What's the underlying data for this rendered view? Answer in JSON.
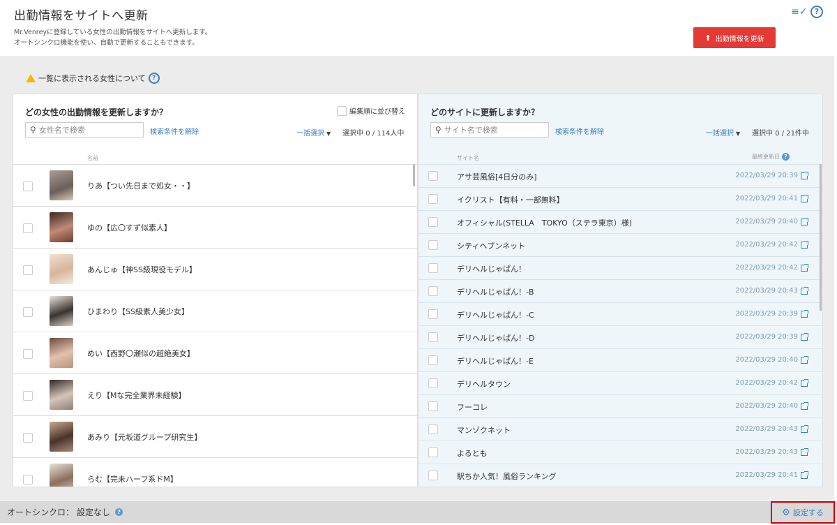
{
  "header": {
    "title": "出勤情報をサイトへ更新",
    "desc_line1": "Mr.Venreyに登録している女性の出勤情報をサイトへ更新します。",
    "desc_line2": "オートシンクロ機能を使い、自動で更新することもできます。",
    "update_button": "出勤情報を更新"
  },
  "notice": {
    "text": "一覧に表示される女性について"
  },
  "left_panel": {
    "title": "どの女性の出勤情報を更新しますか？",
    "sort_label": "編集順に並び替え",
    "search_placeholder": "女性名で検索",
    "clear_label": "検索条件を解除",
    "bulk_label": "一括選択",
    "selected_label": "選択中",
    "selected_count": "0 / 114人中",
    "col_name": "名前",
    "rows": [
      {
        "name": "りあ【つい先日まで処女・・】"
      },
      {
        "name": "ゆの【広〇すず似素人】"
      },
      {
        "name": "あんじゅ【神SS級現役モデル】"
      },
      {
        "name": "ひまわり【SS級素人美少女】"
      },
      {
        "name": "めい【西野〇瀬似の超絶美女】"
      },
      {
        "name": "えり【Mな完全業界未経験】"
      },
      {
        "name": "あみり【元坂道グループ研究生】"
      },
      {
        "name": "らむ【完未ハーフ系ドM】"
      }
    ]
  },
  "right_panel": {
    "title": "どのサイトに更新しますか？",
    "search_placeholder": "サイト名で検索",
    "clear_label": "検索条件を解除",
    "bulk_label": "一括選択",
    "selected_label": "選択中",
    "selected_count": "0 / 21件中",
    "col_site": "サイト名",
    "col_updated": "最終更新日",
    "rows": [
      {
        "site": "アサ芸風俗[4日分のみ]",
        "date": "2022/03/29 20:39"
      },
      {
        "site": "イクリスト【有料・一部無料】",
        "date": "2022/03/29 20:41"
      },
      {
        "site": "オフィシャル(STELLA　TOKYO（ステラ東京）様)",
        "date": "2022/03/29 20:40"
      },
      {
        "site": "シティヘブンネット",
        "date": "2022/03/29 20:42"
      },
      {
        "site": "デリヘルじゃぱん！",
        "date": "2022/03/29 20:42"
      },
      {
        "site": "デリヘルじゃぱん！-B",
        "date": "2022/03/29 20:43"
      },
      {
        "site": "デリヘルじゃぱん！-C",
        "date": "2022/03/29 20:39"
      },
      {
        "site": "デリヘルじゃぱん！-D",
        "date": "2022/03/29 20:39"
      },
      {
        "site": "デリヘルじゃぱん！-E",
        "date": "2022/03/29 20:40"
      },
      {
        "site": "デリヘルタウン",
        "date": "2022/03/29 20:42"
      },
      {
        "site": "フーコレ",
        "date": "2022/03/29 20:40"
      },
      {
        "site": "マンゾクネット",
        "date": "2022/03/29 20:43"
      },
      {
        "site": "よるとも",
        "date": "2022/03/29 20:43"
      },
      {
        "site": "駅ちか人気！風俗ランキング",
        "date": "2022/03/29 20:41"
      }
    ]
  },
  "footer": {
    "auto_sync_label": "オートシンクロ：",
    "auto_sync_value": "設定なし",
    "settings_button": "設定する"
  },
  "colors": {
    "accent": "#3a7fc1",
    "danger": "#e53935",
    "right_panel_bg": "#eef6fa"
  }
}
